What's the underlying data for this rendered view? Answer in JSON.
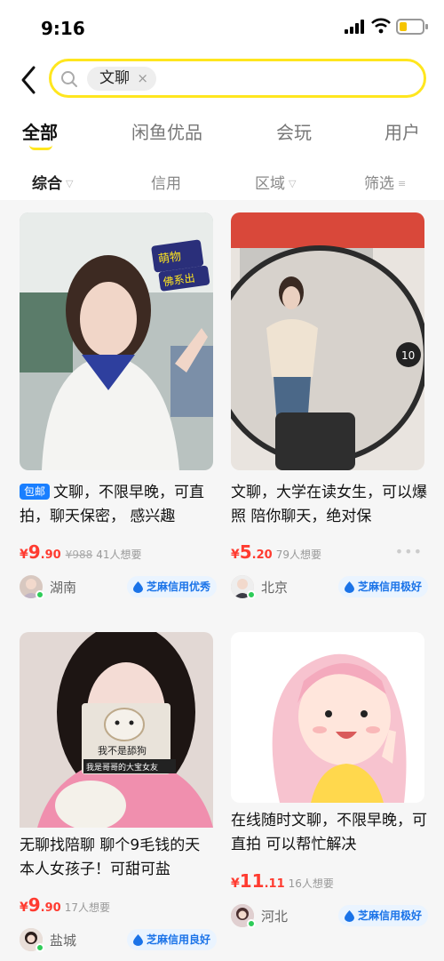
{
  "status_bar": {
    "time": "9:16"
  },
  "search": {
    "query": "文聊",
    "clear": "×"
  },
  "tabs": [
    {
      "label": "全部",
      "active": true
    },
    {
      "label": "闲鱼优品",
      "active": false
    },
    {
      "label": "会玩",
      "active": false
    },
    {
      "label": "用户",
      "active": false
    }
  ],
  "filters": [
    {
      "label": "综合",
      "active": true
    },
    {
      "label": "信用",
      "active": false
    },
    {
      "label": "区域",
      "active": false
    },
    {
      "label": "筛选",
      "active": false
    }
  ],
  "products": [
    {
      "badge": "包邮",
      "title": "文聊，不限早晚，可直拍，聊天保密， 感兴趣",
      "price_currency": "¥",
      "price_int": "9",
      "price_dec": ".90",
      "original_price": "¥988",
      "wants": "41人想要",
      "region": "湖南",
      "credit": "芝麻信用优秀",
      "image_sticker": [
        "萌物",
        "佛系出"
      ]
    },
    {
      "badge": "",
      "title": "文聊，大学在读女生，可以爆照 陪你聊天，绝对保",
      "price_currency": "¥",
      "price_int": "5",
      "price_dec": ".20",
      "original_price": "",
      "wants": "79人想要",
      "region": "北京",
      "credit": "芝麻信用极好",
      "more": "•••",
      "image_sticker": [
        "10"
      ]
    },
    {
      "badge": "",
      "title": "无聊找陪聊 聊个9毛钱的天 本人女孩子！可甜可盐",
      "price_currency": "¥",
      "price_int": "9",
      "price_dec": ".90",
      "original_price": "",
      "wants": "17人想要",
      "region": "盐城",
      "credit": "芝麻信用良好",
      "image_sticker": [
        "我不是舔狗",
        "我是哥哥的大宝女友"
      ]
    },
    {
      "badge": "",
      "title": "在线随时文聊，不限早晚，可直拍 可以帮忙解决",
      "price_currency": "¥",
      "price_int": "11",
      "price_dec": ".11",
      "original_price": "",
      "wants": "16人想要",
      "region": "河北",
      "credit": "芝麻信用极好",
      "image_sticker": []
    }
  ],
  "colors": {
    "accent": "#ffe61e",
    "price": "#ff3b30",
    "credit": "#1a73e8",
    "badge": "#1a7fff"
  }
}
